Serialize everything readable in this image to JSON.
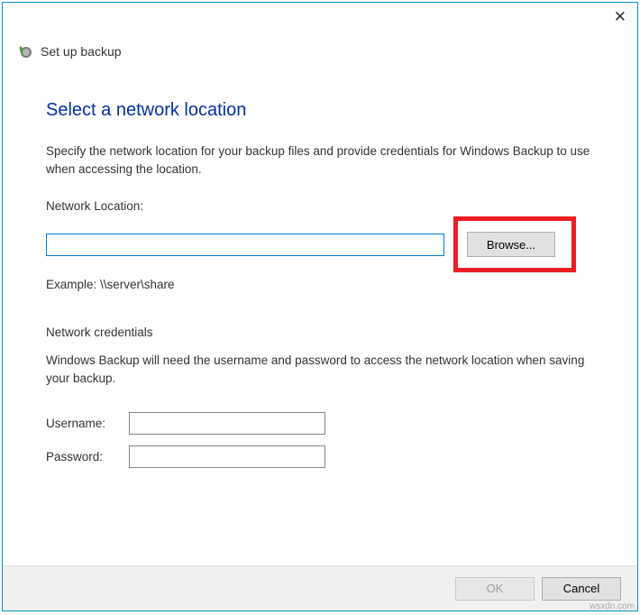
{
  "wizard_title": "Set up backup",
  "page_title": "Select a network location",
  "description": "Specify the network location for your backup files and provide credentials for Windows Backup to use when accessing the location.",
  "network_location": {
    "label": "Network Location:",
    "value": "",
    "browse_label": "Browse...",
    "example": "Example: \\\\server\\share"
  },
  "credentials": {
    "heading": "Network credentials",
    "description": "Windows Backup will need the username and password to access the network location when saving your backup.",
    "username_label": "Username:",
    "username_value": "",
    "password_label": "Password:",
    "password_value": ""
  },
  "footer": {
    "ok_label": "OK",
    "cancel_label": "Cancel"
  },
  "watermark": "wsxdn.com"
}
